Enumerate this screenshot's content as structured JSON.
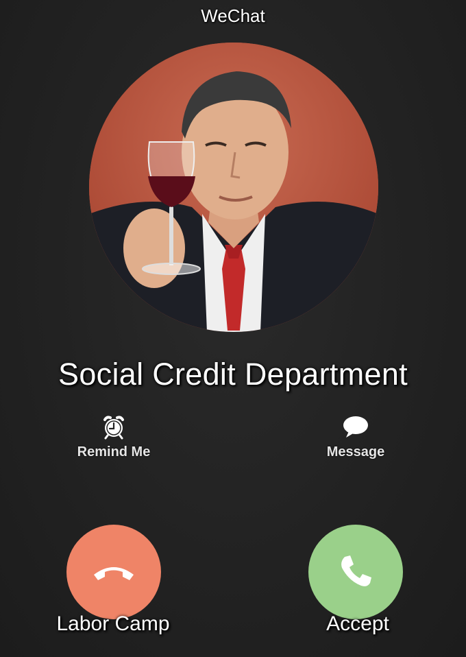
{
  "header": {
    "app_name": "WeChat"
  },
  "caller": {
    "name": "Social Credit Department",
    "avatar_icon": "caller-photo"
  },
  "actions": {
    "remind": {
      "label": "Remind Me",
      "icon": "alarm-clock-icon"
    },
    "message": {
      "label": "Message",
      "icon": "speech-bubble-icon"
    }
  },
  "call_buttons": {
    "decline": {
      "label": "Labor Camp",
      "icon": "hang-up-icon",
      "color": "#ef8467"
    },
    "accept": {
      "label": "Accept",
      "icon": "phone-icon",
      "color": "#9ad08a"
    }
  },
  "colors": {
    "background": "#202020",
    "text": "#ffffff"
  }
}
